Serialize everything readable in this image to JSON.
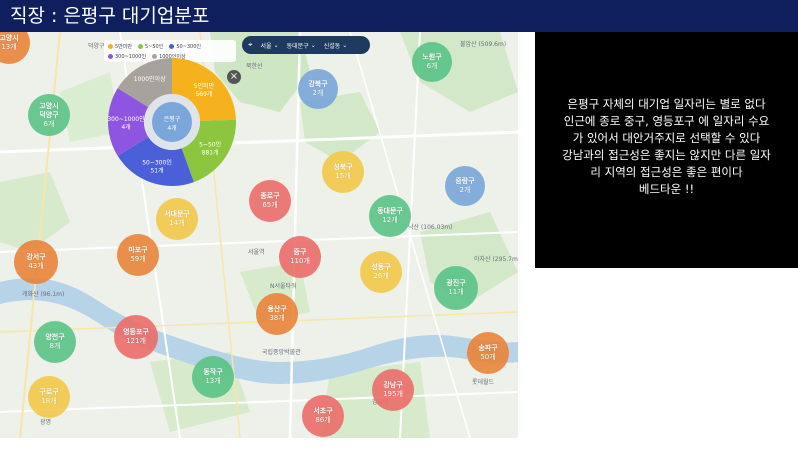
{
  "header": {
    "title": "직장 : 은평구 대기업분포"
  },
  "legend": {
    "items": [
      {
        "label": "5만미만",
        "color": "#f5b21c"
      },
      {
        "label": "5~50인",
        "color": "#8cc63f"
      },
      {
        "label": "50~300인",
        "color": "#4a5fd8"
      },
      {
        "label": "300~1000인",
        "color": "#8e56e0"
      },
      {
        "label": "1000인이상",
        "color": "#a8a29c"
      }
    ]
  },
  "filter": {
    "city": "서울",
    "district": "동대문구",
    "dong": "신설동"
  },
  "donut": {
    "center": {
      "name": "은평구",
      "count": "4개"
    },
    "segments": [
      {
        "label": "5인미만",
        "value": "569개",
        "color": "#f5b21c"
      },
      {
        "label": "5~50인",
        "value": "881개",
        "color": "#8cc63f"
      },
      {
        "label": "50~300인",
        "value": "51개",
        "color": "#4a5fd8"
      },
      {
        "label": "300~1000인",
        "value": "4개",
        "color": "#8e56e0"
      },
      {
        "label": "1000인이상",
        "value": "",
        "color": "#a8a29c"
      }
    ]
  },
  "districts": [
    {
      "name": "고양시",
      "count": "13개",
      "color": "#e9843a"
    },
    {
      "name": "고양시 덕양구",
      "count": "6개",
      "color": "#5ac487"
    },
    {
      "name": "노원구",
      "count": "6개",
      "color": "#5ac487"
    },
    {
      "name": "강북구",
      "count": "2개",
      "color": "#7aa6d9"
    },
    {
      "name": "성북구",
      "count": "15개",
      "color": "#f3c94a"
    },
    {
      "name": "중랑구",
      "count": "2개",
      "color": "#7aa6d9"
    },
    {
      "name": "종로구",
      "count": "65개",
      "color": "#ec6d6a"
    },
    {
      "name": "동대문구",
      "count": "12개",
      "color": "#5ac487"
    },
    {
      "name": "서대문구",
      "count": "14개",
      "color": "#f3c94a"
    },
    {
      "name": "중구",
      "count": "110개",
      "color": "#ec6d6a"
    },
    {
      "name": "강서구",
      "count": "43개",
      "color": "#e9843a"
    },
    {
      "name": "마포구",
      "count": "59개",
      "color": "#e9843a"
    },
    {
      "name": "성동구",
      "count": "26개",
      "color": "#f3c94a"
    },
    {
      "name": "광진구",
      "count": "11개",
      "color": "#5ac487"
    },
    {
      "name": "용산구",
      "count": "38개",
      "color": "#e9843a"
    },
    {
      "name": "양천구",
      "count": "8개",
      "color": "#5ac487"
    },
    {
      "name": "영등포구",
      "count": "121개",
      "color": "#ec6d6a"
    },
    {
      "name": "송파구",
      "count": "50개",
      "color": "#e9843a"
    },
    {
      "name": "동작구",
      "count": "13개",
      "color": "#5ac487"
    },
    {
      "name": "강남구",
      "count": "195개",
      "color": "#ec6d6a"
    },
    {
      "name": "구로구",
      "count": "18개",
      "color": "#f3c94a"
    },
    {
      "name": "서초구",
      "count": "86개",
      "color": "#ec6d6a"
    }
  ],
  "map_labels": {
    "deokyang": "덕양구",
    "bukhansan": "북한산",
    "nowon_mt": "불암산 (509.6m)",
    "naksan": "낙산 (106.03m)",
    "achasan": "아차산 (295.7m)",
    "gaehwa": "개화산 (96.1m)",
    "seoul_station": "서울역",
    "namsan": "N서울타워",
    "kbs": "국립중앙박물관",
    "jamsil": "롯데월드",
    "gangnam_stn": "강남역",
    "gwangmyeong": "광명"
  },
  "commentary": {
    "lines": [
      "은평구 자체의 대기업 일자리는 별로 없다",
      "인근에 종로 중구, 영등포구 에 일자리 수요",
      "가 있어서 대안거주지로 선택할 수 있다",
      "강남과의 접근성은 좋지는 않지만 다른 일자",
      "리 지역의 접근성은 좋은 편이다",
      "베드타운 !!"
    ]
  }
}
